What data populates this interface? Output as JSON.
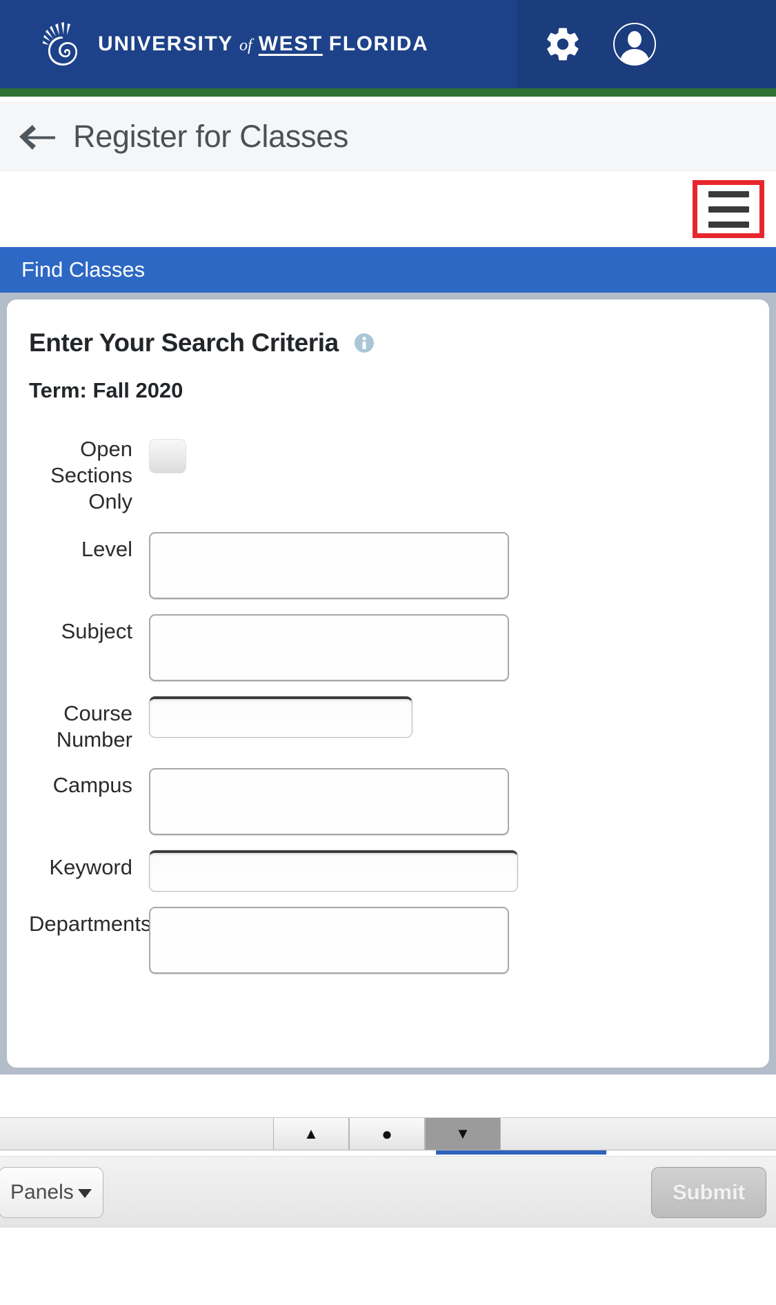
{
  "brand": {
    "logo_icon": "nautilus-shell-icon",
    "name_part1": "UNIVERSITY",
    "name_of": "of",
    "name_part2": "WEST",
    "name_part3": "FLORIDA",
    "gear_icon": "gear-icon",
    "avatar_icon": "user-avatar-icon",
    "bar_color": "#1d4289",
    "bar_right_color": "#1b3c7d",
    "accent_stripe_color": "#2f7132"
  },
  "titlebar": {
    "back_icon": "back-arrow-icon",
    "title": "Register for Classes"
  },
  "hamburger": {
    "icon": "hamburger-menu-icon",
    "highlight_color": "#e8262d"
  },
  "findbar": {
    "label": "Find Classes",
    "color": "#2d68c4"
  },
  "panel": {
    "heading": "Enter Your Search Criteria",
    "info_icon": "info-icon",
    "term": "Term: Fall 2020",
    "fields": [
      {
        "label": "Open Sections Only",
        "type": "checkbox",
        "value": "",
        "checked": false
      },
      {
        "label": "Level",
        "type": "select",
        "value": ""
      },
      {
        "label": "Subject",
        "type": "select",
        "value": ""
      },
      {
        "label": "Course Number",
        "type": "text",
        "value": ""
      },
      {
        "label": "Campus",
        "type": "select",
        "value": ""
      },
      {
        "label": "Keyword",
        "type": "text",
        "value": ""
      },
      {
        "label": "Departments",
        "type": "select",
        "value": ""
      }
    ]
  },
  "scrollbar": {
    "up_glyph": "▲",
    "dot_glyph": "●",
    "down_glyph": "▼",
    "up_icon": "scroll-up-icon",
    "dot_icon": "scroll-dot-icon",
    "down_icon": "scroll-down-icon"
  },
  "progress": {
    "color": "#2f63bd"
  },
  "actionbar": {
    "panels_label": "Panels",
    "panels_caret_icon": "caret-down-icon",
    "submit_label": "Submit"
  }
}
